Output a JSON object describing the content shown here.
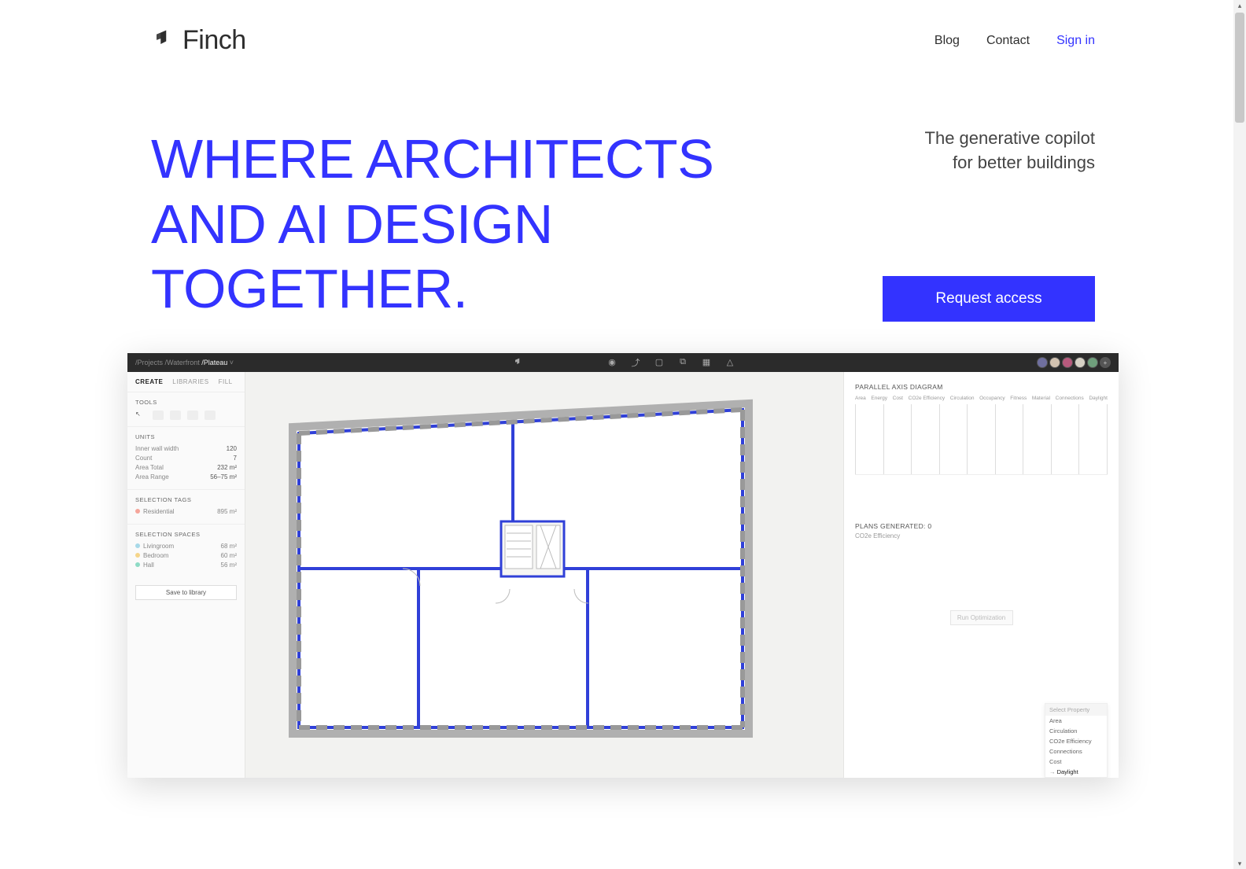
{
  "header": {
    "brand": "Finch",
    "nav": {
      "blog": "Blog",
      "contact": "Contact",
      "signin": "Sign in"
    }
  },
  "hero": {
    "headline": "WHERE ARCHITECTS AND AI DESIGN TOGETHER.",
    "tagline1": "The generative copilot",
    "tagline2": "for better buildings",
    "cta": "Request access"
  },
  "app": {
    "breadcrumbs": {
      "p1": "/Projects",
      "p2": "/Waterfront",
      "p3": "/Plateau"
    },
    "tabs": {
      "create": "CREATE",
      "libraries": "LIBRARIES",
      "fill": "FILL"
    },
    "tools_title": "TOOLS",
    "units": {
      "title": "UNITS",
      "inner_wall_width": {
        "label": "Inner wall width",
        "value": "120"
      },
      "count": {
        "label": "Count",
        "value": "7"
      },
      "area_total": {
        "label": "Area Total",
        "value": "232 m²"
      },
      "area_range": {
        "label": "Area Range",
        "value": "56–75 m²"
      }
    },
    "selection_tags": {
      "title": "SELECTION TAGS",
      "residential": {
        "label": "Residential",
        "value": "895 m²",
        "color": "#f5a59a"
      }
    },
    "selection_spaces": {
      "title": "SELECTION SPACES",
      "livingroom": {
        "label": "Livingroom",
        "value": "68 m²",
        "color": "#a7d9e8"
      },
      "bedroom": {
        "label": "Bedroom",
        "value": "60 m²",
        "color": "#f5d58a"
      },
      "hall": {
        "label": "Hall",
        "value": "56 m²",
        "color": "#8edbc5"
      }
    },
    "save_btn": "Save to library",
    "right": {
      "chart_title": "PARALLEL AXIS DIAGRAM",
      "axes": [
        "Area",
        "Energy",
        "Cost",
        "CO2e Efficiency",
        "Circulation",
        "Occupancy",
        "Fitness",
        "Material",
        "Connections",
        "Daylight"
      ],
      "plans_title": "PLANS GENERATED: 0",
      "plans_sub": "CO2e Efficiency",
      "run_btn": "Run Optimization",
      "popup": {
        "placeholder": "Select Property",
        "items": [
          "Area",
          "Circulation",
          "CO2e Efficiency",
          "Connections",
          "Cost",
          "Daylight"
        ],
        "selected": "Daylight"
      }
    },
    "avatars": [
      "#6f6f9f",
      "#d2c2b0",
      "#b85a7d",
      "#d6d1c5",
      "#6f9f7c",
      "#555"
    ]
  }
}
